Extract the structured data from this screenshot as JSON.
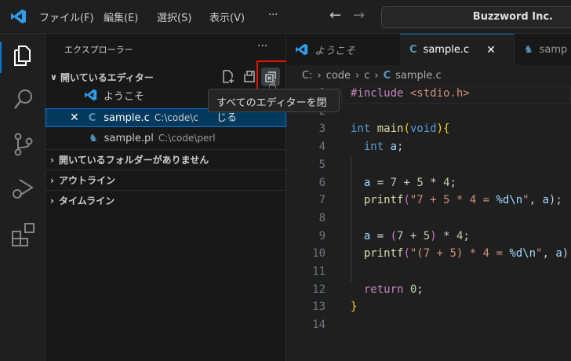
{
  "titlebar": {
    "menus": [
      "ファイル(F)",
      "編集(E)",
      "選択(S)",
      "表示(V)",
      "···"
    ],
    "search": "Buzzword Inc."
  },
  "sidebar": {
    "title": "エクスプローラー",
    "more": "···",
    "open_editors": {
      "label": "開いているエディター",
      "items": [
        {
          "name": "ようこそ",
          "path": ""
        },
        {
          "name": "sample.c",
          "path": "C:\\code\\c"
        },
        {
          "name": "sample.pl",
          "path": "C:\\code\\perl"
        }
      ]
    },
    "sections": [
      "開いているフォルダーがありません",
      "アウトライン",
      "タイムライン"
    ]
  },
  "tooltip": "すべてのエディターを閉じる",
  "tabs": [
    {
      "label": "ようこそ"
    },
    {
      "label": "sample.c"
    },
    {
      "label": "samp"
    }
  ],
  "breadcrumb": [
    "C:",
    "code",
    "c",
    "sample.c"
  ],
  "colors": {
    "accent": "#0078d4",
    "highlight": "#e51400",
    "c_icon": "#519aba"
  },
  "code": [
    [
      [
        "#include ",
        "#c586c0"
      ],
      [
        "<stdio.h>",
        "#ce9178"
      ]
    ],
    [],
    [
      [
        "int ",
        "#569cd6"
      ],
      [
        "main",
        "#dcdcaa"
      ],
      [
        "(",
        "#ffd700"
      ],
      [
        "void",
        "#569cd6"
      ],
      [
        ")",
        "#ffd700"
      ],
      [
        "{",
        "#ffd700"
      ]
    ],
    [
      [
        "  int ",
        "#569cd6"
      ],
      [
        "a",
        "#9cdcfe"
      ],
      [
        ";",
        "#ccc"
      ]
    ],
    [],
    [
      [
        "  a",
        "#9cdcfe"
      ],
      [
        " = ",
        "#d4d4d4"
      ],
      [
        "7",
        "#b5cea8"
      ],
      [
        " + ",
        "#d4d4d4"
      ],
      [
        "5",
        "#b5cea8"
      ],
      [
        " * ",
        "#d4d4d4"
      ],
      [
        "4",
        "#b5cea8"
      ],
      [
        ";",
        "#ccc"
      ]
    ],
    [
      [
        "  printf",
        "#dcdcaa"
      ],
      [
        "(",
        "#da70d6"
      ],
      [
        "\"7 + 5 * 4 = ",
        "#ce9178"
      ],
      [
        "%d\\n",
        "#9cdcfe"
      ],
      [
        "\"",
        "#ce9178"
      ],
      [
        ", ",
        "#ccc"
      ],
      [
        "a",
        "#9cdcfe"
      ],
      [
        ");",
        "#ccc"
      ]
    ],
    [],
    [
      [
        "  a",
        "#9cdcfe"
      ],
      [
        " = ",
        "#d4d4d4"
      ],
      [
        "(",
        "#da70d6"
      ],
      [
        "7",
        "#b5cea8"
      ],
      [
        " + ",
        "#d4d4d4"
      ],
      [
        "5",
        "#b5cea8"
      ],
      [
        ")",
        "#da70d6"
      ],
      [
        " * ",
        "#d4d4d4"
      ],
      [
        "4",
        "#b5cea8"
      ],
      [
        ";",
        "#ccc"
      ]
    ],
    [
      [
        "  printf",
        "#dcdcaa"
      ],
      [
        "(",
        "#da70d6"
      ],
      [
        "\"(7 + 5) * 4 = ",
        "#ce9178"
      ],
      [
        "%d\\n",
        "#9cdcfe"
      ],
      [
        "\"",
        "#ce9178"
      ],
      [
        ", ",
        "#ccc"
      ],
      [
        "a",
        "#9cdcfe"
      ],
      [
        ");",
        "#ccc"
      ]
    ],
    [],
    [
      [
        "  return ",
        "#c586c0"
      ],
      [
        "0",
        "#b5cea8"
      ],
      [
        ";",
        "#ccc"
      ]
    ],
    [
      [
        "}",
        "#ffd700"
      ]
    ],
    []
  ]
}
